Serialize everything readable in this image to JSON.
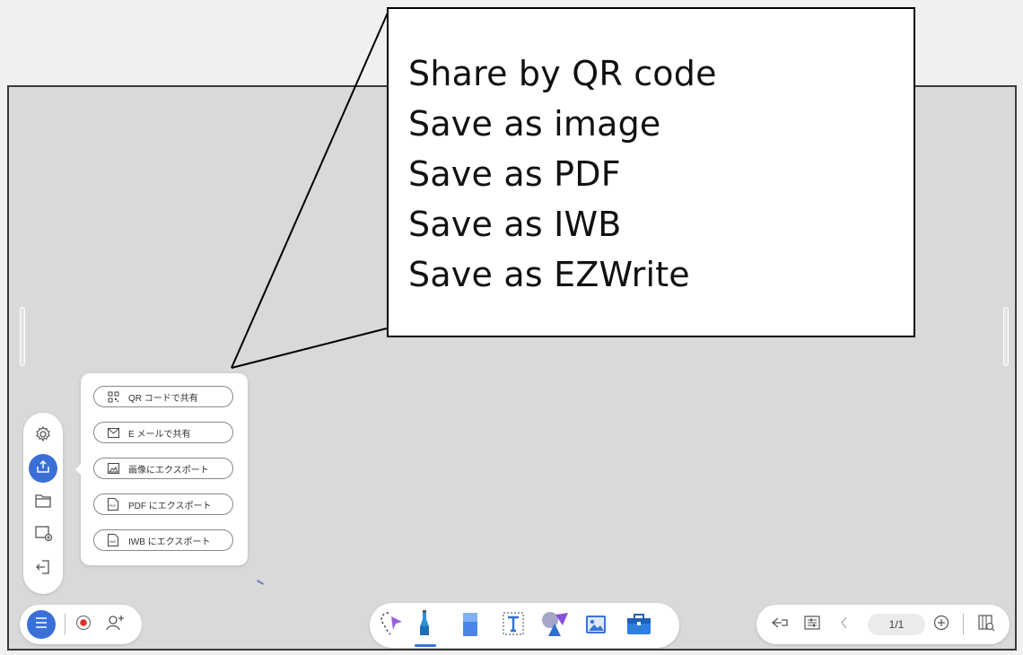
{
  "callout": {
    "lines": [
      "Share by QR code",
      "Save as image",
      "Save as PDF",
      "Save as IWB",
      "Save as EZWrite"
    ]
  },
  "export_menu": {
    "items": [
      {
        "label": "QR コードで共有",
        "icon": "qr-code-icon"
      },
      {
        "label": "E メールで共有",
        "icon": "mail-icon"
      },
      {
        "label": "画像にエクスポート",
        "icon": "image-icon"
      },
      {
        "label": "PDF にエクスポート",
        "icon": "pdf-icon"
      },
      {
        "label": "IWB にエクスポート",
        "icon": "iwb-icon"
      }
    ]
  },
  "left_bar": {
    "items": [
      "gear-icon",
      "share-export-icon",
      "folder-icon",
      "insert-image-icon",
      "exit-icon"
    ]
  },
  "bottom_left": {
    "items": [
      "menu-icon",
      "record-icon",
      "add-user-icon"
    ]
  },
  "toolbar": {
    "tools": [
      "select-lasso-icon",
      "pen-icon",
      "eraser-icon",
      "text-icon",
      "shapes-icon",
      "image-icon",
      "toolbox-icon"
    ]
  },
  "page_nav": {
    "page_indicator": "1/1"
  },
  "colors": {
    "accent": "#3b6fd8",
    "canvas": "#d9d9d9",
    "record": "#d9342b"
  }
}
